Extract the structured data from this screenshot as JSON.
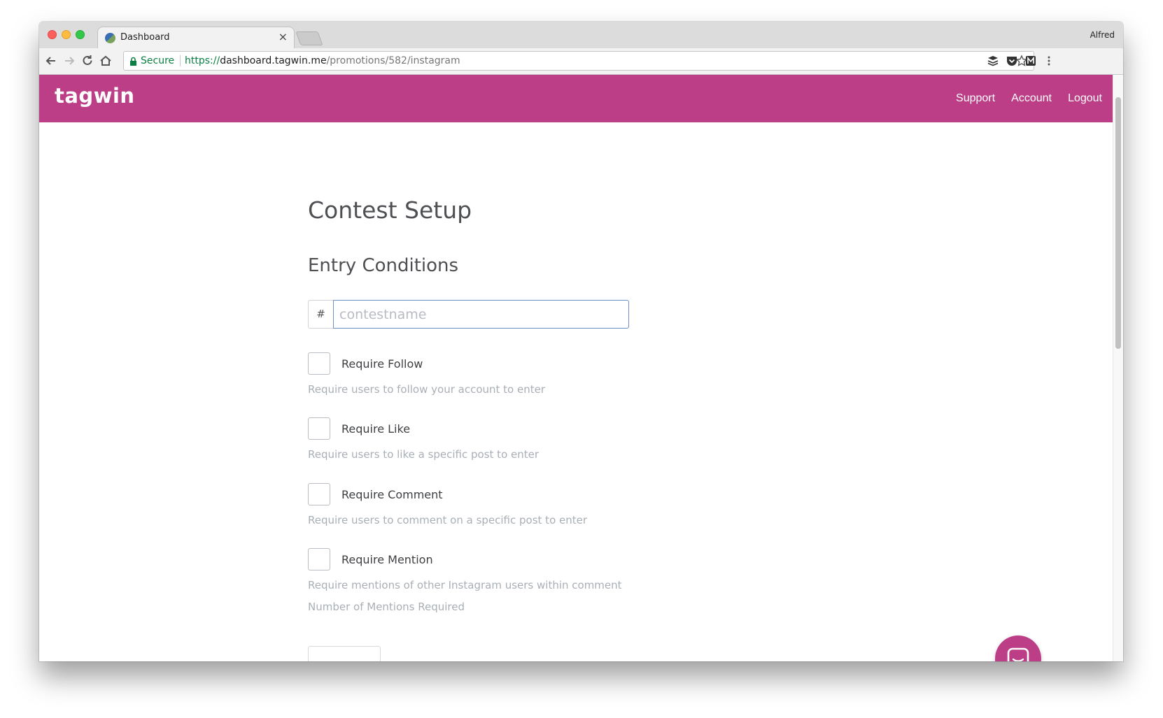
{
  "browser": {
    "tab_title": "Dashboard",
    "tab_close": "×",
    "profile_name": "Alfred",
    "secure_label": "Secure",
    "url_scheme": "https://",
    "url_host": "dashboard.tagwin.me",
    "url_path": "/promotions/582/instagram"
  },
  "app": {
    "logo": "tagwin",
    "nav": {
      "support": "Support",
      "account": "Account",
      "logout": "Logout"
    },
    "brand_color": "#bc3e86"
  },
  "page": {
    "title": "Contest Setup",
    "section_title": "Entry Conditions",
    "hashtag": {
      "prefix": "#",
      "value": "",
      "placeholder": "contestname"
    },
    "conditions": [
      {
        "label": "Require Follow",
        "help": "Require users to follow your account to enter",
        "checked": false
      },
      {
        "label": "Require Like",
        "help": "Require users to like a specific post to enter",
        "checked": false
      },
      {
        "label": "Require Comment",
        "help": "Require users to comment on a specific post to enter",
        "checked": false
      },
      {
        "label": "Require Mention",
        "help": "Require mentions of other Instagram users within comment",
        "checked": false
      }
    ],
    "mentions_label": "Number of Mentions Required"
  },
  "icons": {
    "back": "back-arrow-icon",
    "forward": "forward-arrow-icon",
    "reload": "reload-icon",
    "home": "home-icon",
    "lock": "lock-icon",
    "bookmark": "star-icon",
    "chat": "chat-icon"
  }
}
